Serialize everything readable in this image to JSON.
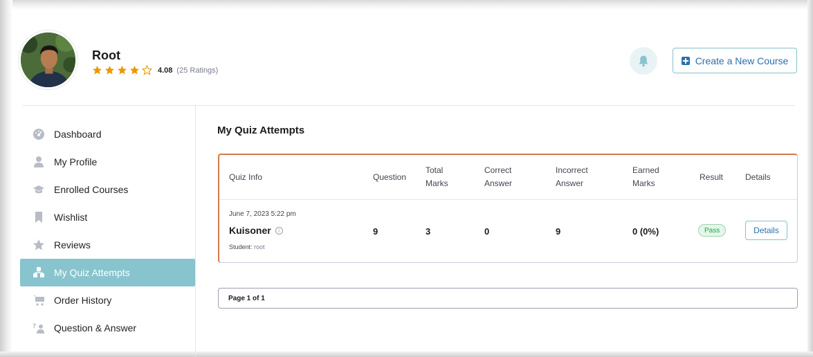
{
  "profile": {
    "name": "Root",
    "rating_value": "4.08",
    "rating_count": "(25 Ratings)",
    "rating_stars": 4,
    "rating_max": 5
  },
  "header": {
    "create_course_label": "Create a New Course"
  },
  "sidebar": {
    "items": [
      {
        "label": "Dashboard",
        "icon": "dashboard-icon"
      },
      {
        "label": "My Profile",
        "icon": "user-icon"
      },
      {
        "label": "Enrolled Courses",
        "icon": "graduation-cap-icon"
      },
      {
        "label": "Wishlist",
        "icon": "bookmark-icon"
      },
      {
        "label": "Reviews",
        "icon": "star-icon"
      },
      {
        "label": "My Quiz Attempts",
        "icon": "quiz-attempts-icon",
        "active": true
      },
      {
        "label": "Order History",
        "icon": "cart-icon"
      },
      {
        "label": "Question & Answer",
        "icon": "question-answer-icon"
      }
    ]
  },
  "main": {
    "title": "My Quiz Attempts",
    "table": {
      "headers": {
        "quiz_info": "Quiz Info",
        "question": "Question",
        "total_marks_1": "Total",
        "total_marks_2": "Marks",
        "correct_1": "Correct",
        "correct_2": "Answer",
        "incorrect_1": "Incorrect",
        "incorrect_2": "Answer",
        "earned_1": "Earned",
        "earned_2": "Marks",
        "result": "Result",
        "details": "Details"
      },
      "rows": [
        {
          "date": "June 7, 2023 5:22 pm",
          "quiz_name": "Kuisoner",
          "student_label": "Student:",
          "student_name": "root",
          "question": "9",
          "total_marks": "3",
          "correct": "0",
          "incorrect": "9",
          "earned": "0 (0%)",
          "result": "Pass",
          "details_label": "Details"
        }
      ]
    },
    "pagination": "Page 1 of 1"
  },
  "colors": {
    "accent": "#88c4cd",
    "link": "#2a6fb0",
    "star": "#ed9700",
    "pass": "#24a148",
    "table_highlight_border": "#d27a47"
  }
}
